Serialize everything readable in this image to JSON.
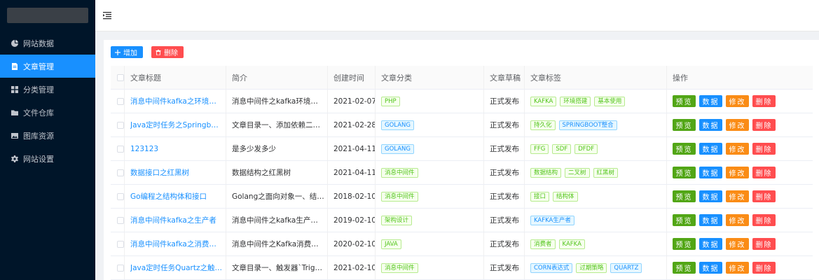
{
  "sidebar": {
    "items": [
      {
        "label": "网站数据",
        "icon": "pie-chart-icon",
        "active": false
      },
      {
        "label": "文章管理",
        "icon": "document-icon",
        "active": true
      },
      {
        "label": "分类管理",
        "icon": "grid-icon",
        "active": false
      },
      {
        "label": "文件仓库",
        "icon": "folder-icon",
        "active": false
      },
      {
        "label": "图库资源",
        "icon": "image-icon",
        "active": false
      },
      {
        "label": "网站设置",
        "icon": "gear-icon",
        "active": false
      }
    ]
  },
  "toolbar": {
    "add_label": "增加",
    "delete_label": "删除"
  },
  "table": {
    "columns": [
      "文章标题",
      "简介",
      "创建时间",
      "文章分类",
      "文章草稿",
      "文章标签",
      "操作"
    ],
    "op_labels": {
      "preview": "预览",
      "data": "数据",
      "edit": "修改",
      "remove": "删除"
    },
    "rows": [
      {
        "title": "消息中间件kafka之环境搭建...",
        "intro": "消息中间件之kafka环境搭建...",
        "date": "2021-02-07",
        "category": {
          "text": "PHP",
          "color": "green"
        },
        "draft": "正式发布",
        "tags": [
          {
            "text": "KAFKA",
            "color": "green"
          },
          {
            "text": "环境搭建",
            "color": "green"
          },
          {
            "text": "基本使用",
            "color": "green"
          }
        ]
      },
      {
        "title": "Java定时任务之Springboot整...",
        "intro": "文章目录一、添加依赖二、添...",
        "date": "2021-02-28",
        "category": {
          "text": "GOLANG",
          "color": "blue"
        },
        "draft": "正式发布",
        "tags": [
          {
            "text": "持久化",
            "color": "green"
          },
          {
            "text": "SPRINGBOOT整合",
            "color": "blue"
          }
        ]
      },
      {
        "title": "123123",
        "intro": "是多少发多少",
        "date": "2021-04-11",
        "category": {
          "text": "GOLANG",
          "color": "blue"
        },
        "draft": "正式发布",
        "tags": [
          {
            "text": "FFG",
            "color": "green"
          },
          {
            "text": "SDF",
            "color": "green"
          },
          {
            "text": "DFDF",
            "color": "green"
          }
        ]
      },
      {
        "title": "数据接口之红黑树",
        "intro": "数据结构之红黑树",
        "date": "2021-04-11",
        "category": {
          "text": "消息中间件",
          "color": "green"
        },
        "draft": "正式发布",
        "tags": [
          {
            "text": "数据结构",
            "color": "green"
          },
          {
            "text": "二叉树",
            "color": "green"
          },
          {
            "text": "红黑树",
            "color": "green"
          }
        ]
      },
      {
        "title": "Go编程之结构体和接口",
        "intro": "Golang之面向对象一、结构...",
        "date": "2018-02-10",
        "category": {
          "text": "消息中间件",
          "color": "green"
        },
        "draft": "正式发布",
        "tags": [
          {
            "text": "接口",
            "color": "green"
          },
          {
            "text": "结构体",
            "color": "green"
          }
        ]
      },
      {
        "title": "消息中间件kafka之生产者",
        "intro": "消息中间件之kafka生产者二...",
        "date": "2019-02-10",
        "category": {
          "text": "架构设计",
          "color": "green"
        },
        "draft": "正式发布",
        "tags": [
          {
            "text": "KAFKA生产者",
            "color": "blue"
          }
        ]
      },
      {
        "title": "消息中间件kafka之消费者相...",
        "intro": "消息中间件之Kafka消费者一...",
        "date": "2020-02-10",
        "category": {
          "text": "JAVA",
          "color": "green"
        },
        "draft": "正式发布",
        "tags": [
          {
            "text": "消费者",
            "color": "green"
          },
          {
            "text": "KAFKA",
            "color": "green"
          }
        ]
      },
      {
        "title": "Java定时任务Quartz之触发器...",
        "intro": "文章目录一、触发器`Trigger`...",
        "date": "2021-02-10",
        "category": {
          "text": "消息中间件",
          "color": "green"
        },
        "draft": "正式发布",
        "tags": [
          {
            "text": "CORN表达式",
            "color": "blue"
          },
          {
            "text": "过期策略",
            "color": "green"
          },
          {
            "text": "QUARTZ",
            "color": "blue"
          }
        ]
      }
    ]
  }
}
